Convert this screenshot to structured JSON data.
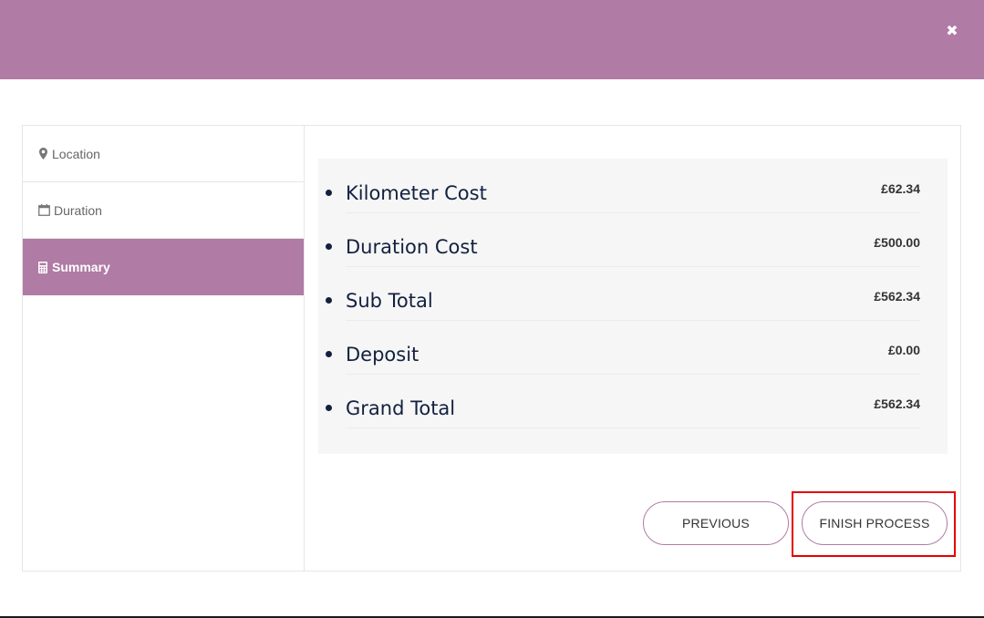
{
  "header": {
    "close_icon": "close-icon",
    "background": "#b07ba5"
  },
  "sidebar": {
    "items": [
      {
        "label": "Location",
        "icon": "map-marker-icon",
        "active": false
      },
      {
        "label": "Duration",
        "icon": "calendar-icon",
        "active": false
      },
      {
        "label": "Summary",
        "icon": "calculator-icon",
        "active": true
      }
    ]
  },
  "summary": {
    "rows": [
      {
        "label": "Kilometer Cost",
        "amount": "£62.34"
      },
      {
        "label": "Duration Cost",
        "amount": "£500.00"
      },
      {
        "label": "Sub Total",
        "amount": "£562.34"
      },
      {
        "label": "Deposit",
        "amount": "£0.00"
      },
      {
        "label": "Grand Total",
        "amount": "£562.34"
      }
    ]
  },
  "buttons": {
    "previous_label": "PREVIOUS",
    "finish_label": "FINISH PROCESS"
  },
  "colors": {
    "accent": "#b07ba5",
    "highlight": "#e60000",
    "text_dark": "#13213f"
  }
}
